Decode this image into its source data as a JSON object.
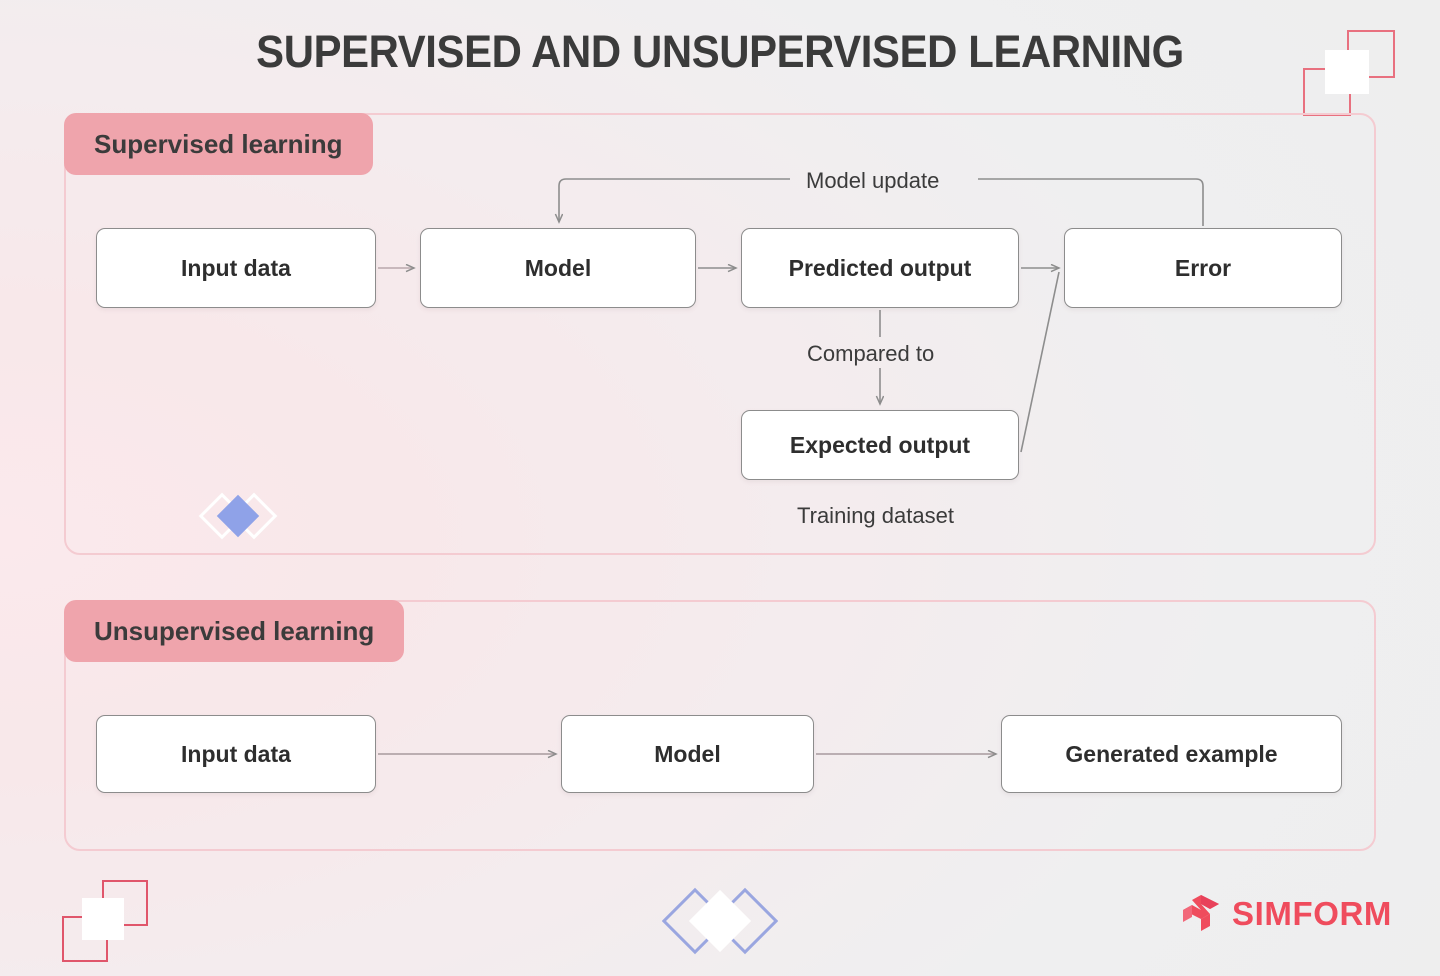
{
  "page": {
    "title": "SUPERVISED AND UNSUPERVISED LEARNING",
    "background_left": "#fbe9ec",
    "background_right": "#eeeeee"
  },
  "colors": {
    "badge_pink": "#efa4ac",
    "panel_border": "#f4cbd1",
    "node_border": "#8c8c8c",
    "node_fill": "#ffffff",
    "text_dark": "#3b3b3b",
    "connector_gray": "#8d8d8d",
    "brand_red": "#ef4c5d",
    "accent_blue": "#8fa2e8",
    "deco_pink": "#e8707f"
  },
  "sections": [
    {
      "id": "supervised",
      "badge_label": "Supervised learning",
      "nodes": [
        {
          "id": "s-input",
          "label": "Input data"
        },
        {
          "id": "s-model",
          "label": "Model"
        },
        {
          "id": "s-predicted",
          "label": "Predicted output"
        },
        {
          "id": "s-error",
          "label": "Error"
        },
        {
          "id": "s-expected",
          "label": "Expected output"
        }
      ],
      "edge_labels": [
        {
          "id": "model-update",
          "label": "Model update"
        },
        {
          "id": "compared-to",
          "label": "Compared to"
        }
      ],
      "captions": [
        {
          "id": "training-dataset",
          "label": "Training dataset"
        }
      ],
      "flow": [
        {
          "from": "Input data",
          "to": "Model",
          "label": ""
        },
        {
          "from": "Model",
          "to": "Predicted output",
          "label": ""
        },
        {
          "from": "Predicted output",
          "to": "Error",
          "label": ""
        },
        {
          "from": "Predicted output",
          "to": "Expected output",
          "label": "Compared to"
        },
        {
          "from": "Expected output",
          "to": "Error",
          "label": ""
        },
        {
          "from": "Error",
          "to": "Model",
          "label": "Model update"
        }
      ]
    },
    {
      "id": "unsupervised",
      "badge_label": "Unsupervised learning",
      "nodes": [
        {
          "id": "u-input",
          "label": "Input data"
        },
        {
          "id": "u-model",
          "label": "Model"
        },
        {
          "id": "u-generated",
          "label": "Generated example"
        }
      ],
      "edge_labels": [],
      "captions": [],
      "flow": [
        {
          "from": "Input data",
          "to": "Model",
          "label": ""
        },
        {
          "from": "Model",
          "to": "Generated example",
          "label": ""
        }
      ]
    }
  ],
  "branding": {
    "logo_mark": "simform-logo-icon",
    "logo_text": "SIMFORM"
  },
  "decorations": [
    {
      "id": "top-right-squares",
      "type": "overlapping-squares",
      "color": "#e8707f"
    },
    {
      "id": "bottom-left-squares",
      "type": "overlapping-squares",
      "color": "#e0566b"
    },
    {
      "id": "supervised-diamonds",
      "type": "diamond-trio",
      "color": "#8fa2e8"
    },
    {
      "id": "bottom-center-diamonds",
      "type": "diamond-trio",
      "color": "#8fa2e8"
    }
  ]
}
